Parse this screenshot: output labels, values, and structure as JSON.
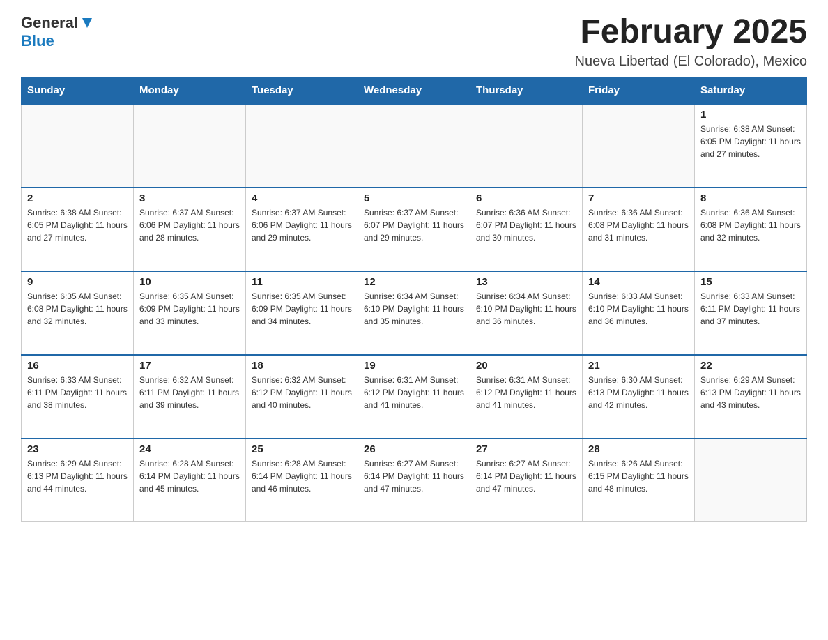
{
  "header": {
    "logo_general": "General",
    "logo_blue": "Blue",
    "month_title": "February 2025",
    "location": "Nueva Libertad (El Colorado), Mexico"
  },
  "days_of_week": [
    "Sunday",
    "Monday",
    "Tuesday",
    "Wednesday",
    "Thursday",
    "Friday",
    "Saturday"
  ],
  "weeks": [
    [
      {
        "day": "",
        "info": ""
      },
      {
        "day": "",
        "info": ""
      },
      {
        "day": "",
        "info": ""
      },
      {
        "day": "",
        "info": ""
      },
      {
        "day": "",
        "info": ""
      },
      {
        "day": "",
        "info": ""
      },
      {
        "day": "1",
        "info": "Sunrise: 6:38 AM\nSunset: 6:05 PM\nDaylight: 11 hours\nand 27 minutes."
      }
    ],
    [
      {
        "day": "2",
        "info": "Sunrise: 6:38 AM\nSunset: 6:05 PM\nDaylight: 11 hours\nand 27 minutes."
      },
      {
        "day": "3",
        "info": "Sunrise: 6:37 AM\nSunset: 6:06 PM\nDaylight: 11 hours\nand 28 minutes."
      },
      {
        "day": "4",
        "info": "Sunrise: 6:37 AM\nSunset: 6:06 PM\nDaylight: 11 hours\nand 29 minutes."
      },
      {
        "day": "5",
        "info": "Sunrise: 6:37 AM\nSunset: 6:07 PM\nDaylight: 11 hours\nand 29 minutes."
      },
      {
        "day": "6",
        "info": "Sunrise: 6:36 AM\nSunset: 6:07 PM\nDaylight: 11 hours\nand 30 minutes."
      },
      {
        "day": "7",
        "info": "Sunrise: 6:36 AM\nSunset: 6:08 PM\nDaylight: 11 hours\nand 31 minutes."
      },
      {
        "day": "8",
        "info": "Sunrise: 6:36 AM\nSunset: 6:08 PM\nDaylight: 11 hours\nand 32 minutes."
      }
    ],
    [
      {
        "day": "9",
        "info": "Sunrise: 6:35 AM\nSunset: 6:08 PM\nDaylight: 11 hours\nand 32 minutes."
      },
      {
        "day": "10",
        "info": "Sunrise: 6:35 AM\nSunset: 6:09 PM\nDaylight: 11 hours\nand 33 minutes."
      },
      {
        "day": "11",
        "info": "Sunrise: 6:35 AM\nSunset: 6:09 PM\nDaylight: 11 hours\nand 34 minutes."
      },
      {
        "day": "12",
        "info": "Sunrise: 6:34 AM\nSunset: 6:10 PM\nDaylight: 11 hours\nand 35 minutes."
      },
      {
        "day": "13",
        "info": "Sunrise: 6:34 AM\nSunset: 6:10 PM\nDaylight: 11 hours\nand 36 minutes."
      },
      {
        "day": "14",
        "info": "Sunrise: 6:33 AM\nSunset: 6:10 PM\nDaylight: 11 hours\nand 36 minutes."
      },
      {
        "day": "15",
        "info": "Sunrise: 6:33 AM\nSunset: 6:11 PM\nDaylight: 11 hours\nand 37 minutes."
      }
    ],
    [
      {
        "day": "16",
        "info": "Sunrise: 6:33 AM\nSunset: 6:11 PM\nDaylight: 11 hours\nand 38 minutes."
      },
      {
        "day": "17",
        "info": "Sunrise: 6:32 AM\nSunset: 6:11 PM\nDaylight: 11 hours\nand 39 minutes."
      },
      {
        "day": "18",
        "info": "Sunrise: 6:32 AM\nSunset: 6:12 PM\nDaylight: 11 hours\nand 40 minutes."
      },
      {
        "day": "19",
        "info": "Sunrise: 6:31 AM\nSunset: 6:12 PM\nDaylight: 11 hours\nand 41 minutes."
      },
      {
        "day": "20",
        "info": "Sunrise: 6:31 AM\nSunset: 6:12 PM\nDaylight: 11 hours\nand 41 minutes."
      },
      {
        "day": "21",
        "info": "Sunrise: 6:30 AM\nSunset: 6:13 PM\nDaylight: 11 hours\nand 42 minutes."
      },
      {
        "day": "22",
        "info": "Sunrise: 6:29 AM\nSunset: 6:13 PM\nDaylight: 11 hours\nand 43 minutes."
      }
    ],
    [
      {
        "day": "23",
        "info": "Sunrise: 6:29 AM\nSunset: 6:13 PM\nDaylight: 11 hours\nand 44 minutes."
      },
      {
        "day": "24",
        "info": "Sunrise: 6:28 AM\nSunset: 6:14 PM\nDaylight: 11 hours\nand 45 minutes."
      },
      {
        "day": "25",
        "info": "Sunrise: 6:28 AM\nSunset: 6:14 PM\nDaylight: 11 hours\nand 46 minutes."
      },
      {
        "day": "26",
        "info": "Sunrise: 6:27 AM\nSunset: 6:14 PM\nDaylight: 11 hours\nand 47 minutes."
      },
      {
        "day": "27",
        "info": "Sunrise: 6:27 AM\nSunset: 6:14 PM\nDaylight: 11 hours\nand 47 minutes."
      },
      {
        "day": "28",
        "info": "Sunrise: 6:26 AM\nSunset: 6:15 PM\nDaylight: 11 hours\nand 48 minutes."
      },
      {
        "day": "",
        "info": ""
      }
    ]
  ]
}
